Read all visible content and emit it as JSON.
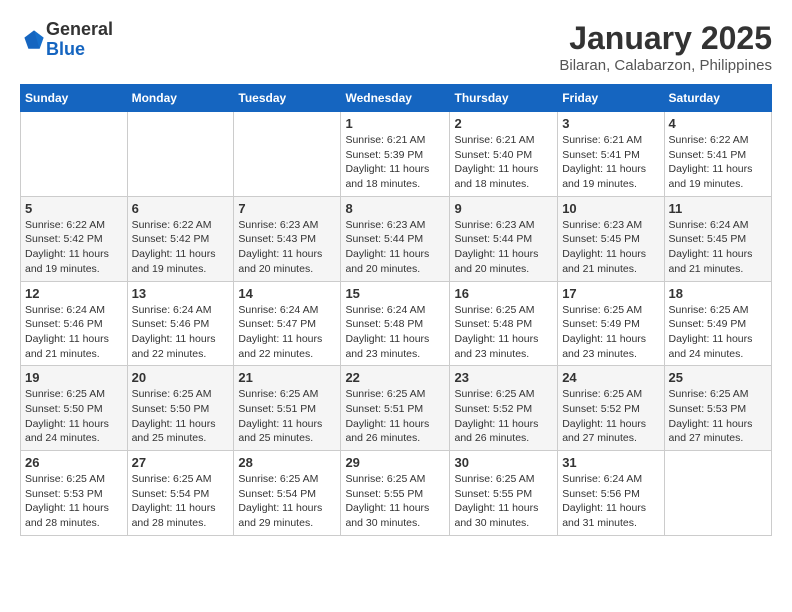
{
  "logo": {
    "general": "General",
    "blue": "Blue"
  },
  "title": "January 2025",
  "location": "Bilaran, Calabarzon, Philippines",
  "days_header": [
    "Sunday",
    "Monday",
    "Tuesday",
    "Wednesday",
    "Thursday",
    "Friday",
    "Saturday"
  ],
  "weeks": [
    [
      {
        "day": "",
        "info": ""
      },
      {
        "day": "",
        "info": ""
      },
      {
        "day": "",
        "info": ""
      },
      {
        "day": "1",
        "info": "Sunrise: 6:21 AM\nSunset: 5:39 PM\nDaylight: 11 hours and 18 minutes."
      },
      {
        "day": "2",
        "info": "Sunrise: 6:21 AM\nSunset: 5:40 PM\nDaylight: 11 hours and 18 minutes."
      },
      {
        "day": "3",
        "info": "Sunrise: 6:21 AM\nSunset: 5:41 PM\nDaylight: 11 hours and 19 minutes."
      },
      {
        "day": "4",
        "info": "Sunrise: 6:22 AM\nSunset: 5:41 PM\nDaylight: 11 hours and 19 minutes."
      }
    ],
    [
      {
        "day": "5",
        "info": "Sunrise: 6:22 AM\nSunset: 5:42 PM\nDaylight: 11 hours and 19 minutes."
      },
      {
        "day": "6",
        "info": "Sunrise: 6:22 AM\nSunset: 5:42 PM\nDaylight: 11 hours and 19 minutes."
      },
      {
        "day": "7",
        "info": "Sunrise: 6:23 AM\nSunset: 5:43 PM\nDaylight: 11 hours and 20 minutes."
      },
      {
        "day": "8",
        "info": "Sunrise: 6:23 AM\nSunset: 5:44 PM\nDaylight: 11 hours and 20 minutes."
      },
      {
        "day": "9",
        "info": "Sunrise: 6:23 AM\nSunset: 5:44 PM\nDaylight: 11 hours and 20 minutes."
      },
      {
        "day": "10",
        "info": "Sunrise: 6:23 AM\nSunset: 5:45 PM\nDaylight: 11 hours and 21 minutes."
      },
      {
        "day": "11",
        "info": "Sunrise: 6:24 AM\nSunset: 5:45 PM\nDaylight: 11 hours and 21 minutes."
      }
    ],
    [
      {
        "day": "12",
        "info": "Sunrise: 6:24 AM\nSunset: 5:46 PM\nDaylight: 11 hours and 21 minutes."
      },
      {
        "day": "13",
        "info": "Sunrise: 6:24 AM\nSunset: 5:46 PM\nDaylight: 11 hours and 22 minutes."
      },
      {
        "day": "14",
        "info": "Sunrise: 6:24 AM\nSunset: 5:47 PM\nDaylight: 11 hours and 22 minutes."
      },
      {
        "day": "15",
        "info": "Sunrise: 6:24 AM\nSunset: 5:48 PM\nDaylight: 11 hours and 23 minutes."
      },
      {
        "day": "16",
        "info": "Sunrise: 6:25 AM\nSunset: 5:48 PM\nDaylight: 11 hours and 23 minutes."
      },
      {
        "day": "17",
        "info": "Sunrise: 6:25 AM\nSunset: 5:49 PM\nDaylight: 11 hours and 23 minutes."
      },
      {
        "day": "18",
        "info": "Sunrise: 6:25 AM\nSunset: 5:49 PM\nDaylight: 11 hours and 24 minutes."
      }
    ],
    [
      {
        "day": "19",
        "info": "Sunrise: 6:25 AM\nSunset: 5:50 PM\nDaylight: 11 hours and 24 minutes."
      },
      {
        "day": "20",
        "info": "Sunrise: 6:25 AM\nSunset: 5:50 PM\nDaylight: 11 hours and 25 minutes."
      },
      {
        "day": "21",
        "info": "Sunrise: 6:25 AM\nSunset: 5:51 PM\nDaylight: 11 hours and 25 minutes."
      },
      {
        "day": "22",
        "info": "Sunrise: 6:25 AM\nSunset: 5:51 PM\nDaylight: 11 hours and 26 minutes."
      },
      {
        "day": "23",
        "info": "Sunrise: 6:25 AM\nSunset: 5:52 PM\nDaylight: 11 hours and 26 minutes."
      },
      {
        "day": "24",
        "info": "Sunrise: 6:25 AM\nSunset: 5:52 PM\nDaylight: 11 hours and 27 minutes."
      },
      {
        "day": "25",
        "info": "Sunrise: 6:25 AM\nSunset: 5:53 PM\nDaylight: 11 hours and 27 minutes."
      }
    ],
    [
      {
        "day": "26",
        "info": "Sunrise: 6:25 AM\nSunset: 5:53 PM\nDaylight: 11 hours and 28 minutes."
      },
      {
        "day": "27",
        "info": "Sunrise: 6:25 AM\nSunset: 5:54 PM\nDaylight: 11 hours and 28 minutes."
      },
      {
        "day": "28",
        "info": "Sunrise: 6:25 AM\nSunset: 5:54 PM\nDaylight: 11 hours and 29 minutes."
      },
      {
        "day": "29",
        "info": "Sunrise: 6:25 AM\nSunset: 5:55 PM\nDaylight: 11 hours and 30 minutes."
      },
      {
        "day": "30",
        "info": "Sunrise: 6:25 AM\nSunset: 5:55 PM\nDaylight: 11 hours and 30 minutes."
      },
      {
        "day": "31",
        "info": "Sunrise: 6:24 AM\nSunset: 5:56 PM\nDaylight: 11 hours and 31 minutes."
      },
      {
        "day": "",
        "info": ""
      }
    ]
  ]
}
